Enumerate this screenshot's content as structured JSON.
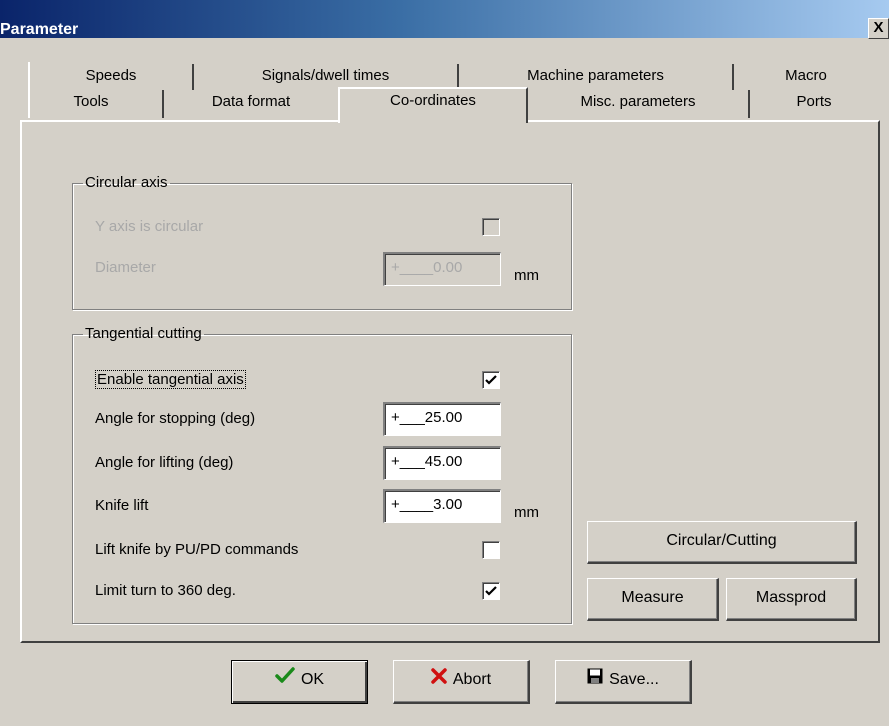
{
  "window": {
    "title": "Parameter",
    "close_label": "X"
  },
  "tabs": {
    "row1": [
      "Speeds",
      "Signals/dwell times",
      "Machine parameters",
      "Macro"
    ],
    "row2": [
      "Tools",
      "Data format",
      "Co-ordinates",
      "Misc. parameters",
      "Ports"
    ],
    "active": "Co-ordinates"
  },
  "circular_axis": {
    "title": "Circular axis",
    "y_axis_label": "Y axis is circular",
    "y_axis_checked": false,
    "diameter_label": "Diameter",
    "diameter_value": "+____0.00",
    "diameter_unit": "mm"
  },
  "tangential": {
    "title": "Tangential cutting",
    "enable_label": "Enable tangential axis",
    "enable_checked": true,
    "angle_stop_label": "Angle for stopping (deg)",
    "angle_stop_value": "+___25.00",
    "angle_lift_label": "Angle for lifting (deg)",
    "angle_lift_value": "+___45.00",
    "knife_lift_label": "Knife lift",
    "knife_lift_value": "+____3.00",
    "knife_lift_unit": "mm",
    "pupd_label": "Lift knife by PU/PD commands",
    "pupd_checked": false,
    "limit_label": "Limit turn to 360 deg.",
    "limit_checked": true
  },
  "side_buttons": {
    "circular_cutting": "Circular/Cutting",
    "measure": "Measure",
    "massprod": "Massprod"
  },
  "footer": {
    "ok": "OK",
    "abort": "Abort",
    "save": "Save..."
  },
  "icons": {
    "ok": "check-icon",
    "abort": "x-icon",
    "save": "floppy-icon"
  },
  "colors": {
    "title_bar": "#0a246a",
    "face": "#d4d0c8",
    "ok_check": "#1a8a1a",
    "abort_x": "#d01010",
    "disabled_text": "#a8a8a8"
  }
}
